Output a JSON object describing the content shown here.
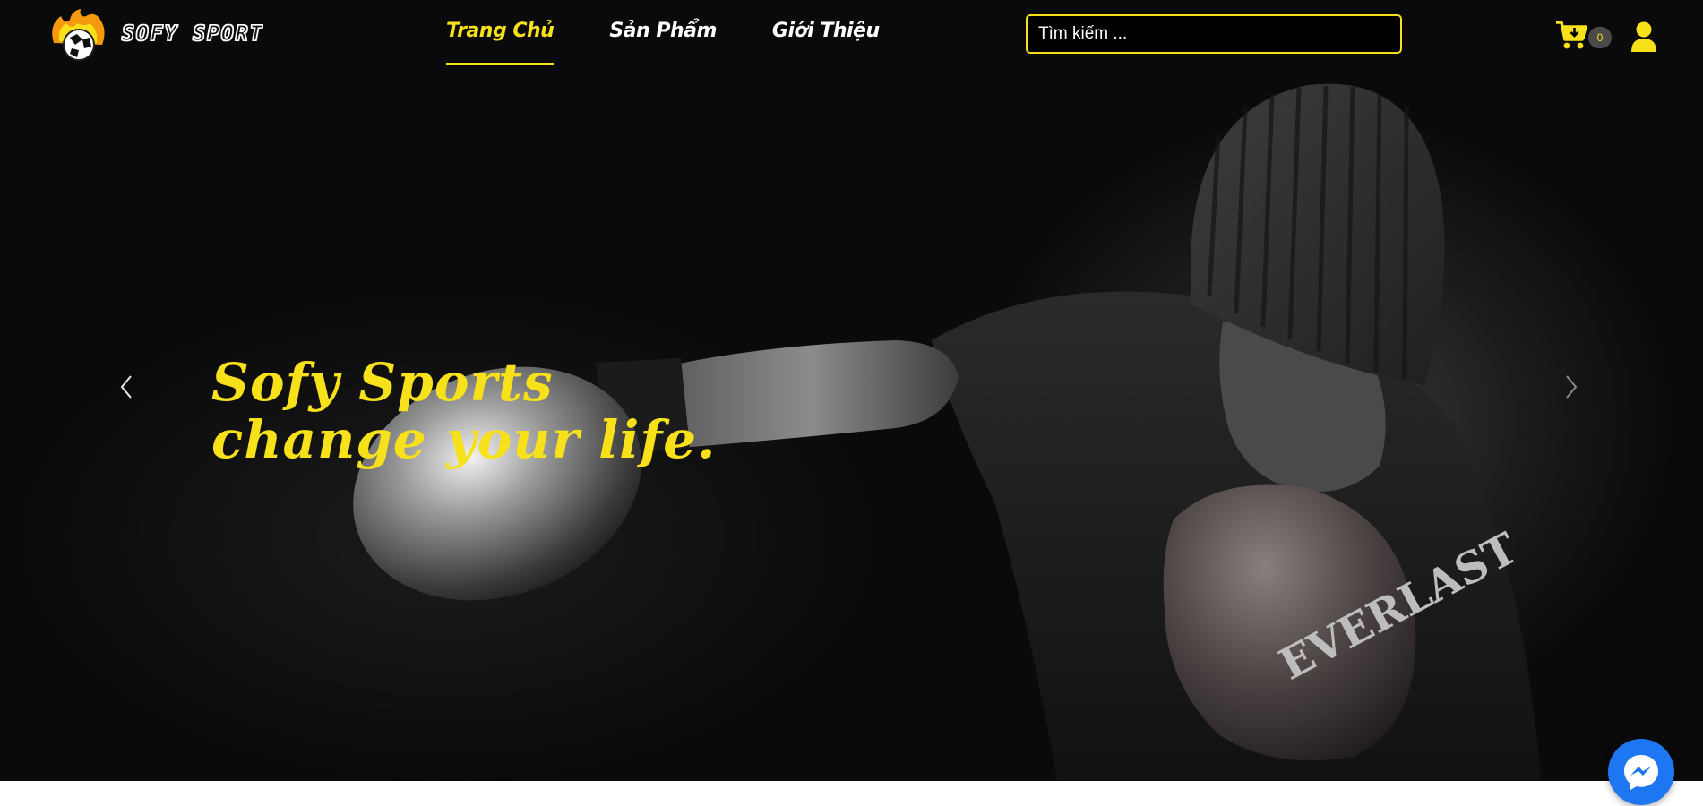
{
  "brand": {
    "name": "SOFY SPORT",
    "accent_color": "#f7e11b"
  },
  "nav": {
    "items": [
      {
        "label": "Trang Chủ",
        "active": true
      },
      {
        "label": "Sản Phẩm",
        "active": false
      },
      {
        "label": "Giới Thiệu",
        "active": false
      }
    ]
  },
  "search": {
    "placeholder": "Tìm kiếm ..."
  },
  "cart": {
    "count": "0",
    "icon": "cart-plus-icon"
  },
  "user": {
    "icon": "user-icon"
  },
  "hero": {
    "line1": "Sofy Sports",
    "line2": "change your life.",
    "prev_icon": "chevron-left-icon",
    "next_icon": "chevron-right-icon"
  },
  "messenger": {
    "icon": "messenger-icon",
    "color": "#1e77f2"
  }
}
